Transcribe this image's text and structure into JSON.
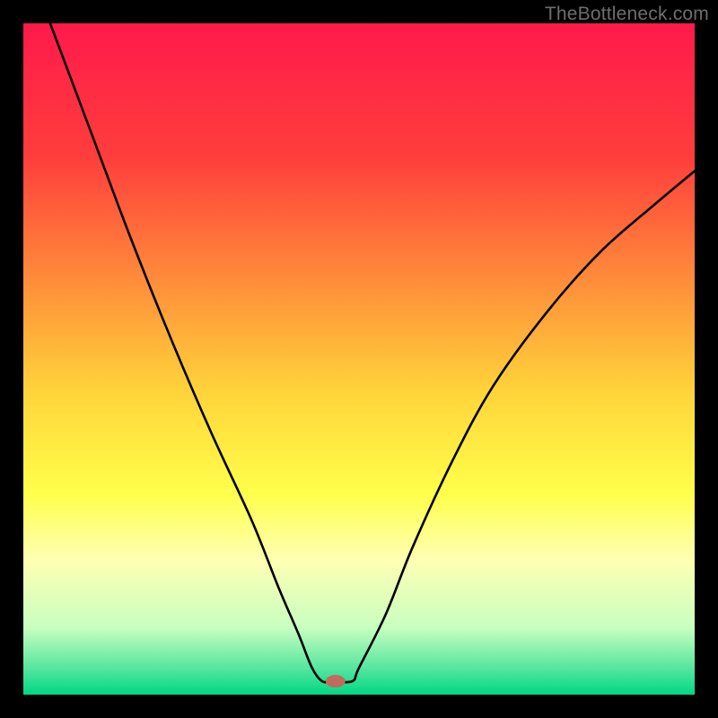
{
  "watermark": "TheBottleneck.com",
  "chart_data": {
    "type": "line",
    "title": "",
    "xlabel": "",
    "ylabel": "",
    "xlim": [
      0,
      100
    ],
    "ylim": [
      0,
      100
    ],
    "gradient_stops": [
      {
        "offset": 0,
        "color": "#ff1a4b"
      },
      {
        "offset": 20,
        "color": "#ff3e3c"
      },
      {
        "offset": 40,
        "color": "#ff943a"
      },
      {
        "offset": 55,
        "color": "#ffd43a"
      },
      {
        "offset": 70,
        "color": "#ffff4a"
      },
      {
        "offset": 80,
        "color": "#feffb3"
      },
      {
        "offset": 90,
        "color": "#c8ffc0"
      },
      {
        "offset": 96,
        "color": "#57e6a0"
      },
      {
        "offset": 100,
        "color": "#00d883"
      }
    ],
    "series": [
      {
        "name": "bottleneck-curve",
        "x": [
          4,
          10,
          16,
          22,
          28,
          34,
          38,
          41,
          43,
          44.5,
          46,
          49,
          50,
          54,
          58,
          64,
          70,
          78,
          86,
          94,
          100
        ],
        "values": [
          100,
          84,
          68,
          53,
          39,
          26,
          16,
          9,
          4,
          2,
          2,
          2,
          4,
          12,
          22,
          35,
          46,
          57,
          66,
          73,
          78
        ]
      }
    ],
    "marker": {
      "name": "sweet-spot-marker",
      "x": 46.5,
      "y": 2.0,
      "color": "#c36a5d",
      "rx": 11,
      "ry": 7
    }
  }
}
